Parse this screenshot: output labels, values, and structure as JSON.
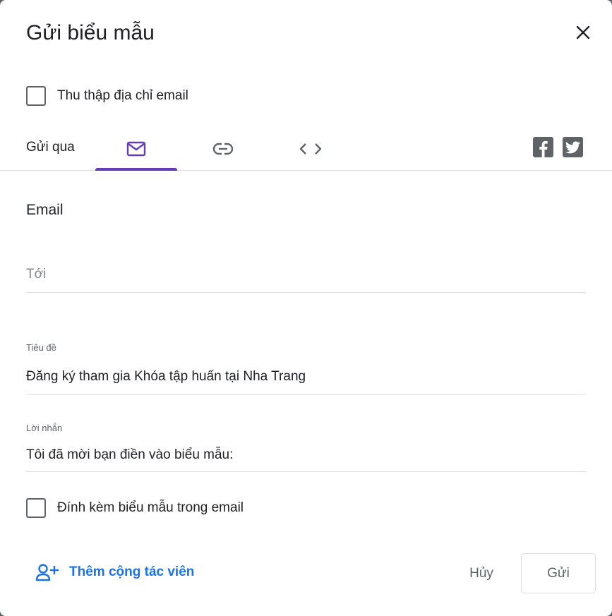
{
  "dialog": {
    "title": "Gửi biểu mẫu",
    "close_icon": "close-icon"
  },
  "collect_email": {
    "label": "Thu thập địa chỉ email",
    "checked": false
  },
  "send_via": {
    "label": "Gửi qua",
    "tabs": [
      {
        "name": "email",
        "icon": "mail-icon",
        "active": true
      },
      {
        "name": "link",
        "icon": "link-icon",
        "active": false
      },
      {
        "name": "embed",
        "icon": "code-icon",
        "active": false
      }
    ],
    "social": [
      {
        "name": "facebook",
        "icon": "facebook-icon"
      },
      {
        "name": "twitter",
        "icon": "twitter-icon"
      }
    ],
    "accent_color": "#673ab7"
  },
  "email_section": {
    "heading": "Email",
    "to": {
      "placeholder": "Tới",
      "value": ""
    },
    "subject": {
      "label": "Tiêu đề",
      "value": "Đăng ký tham gia Khóa tập huấn tại Nha Trang"
    },
    "message": {
      "label": "Lời nhắn",
      "value": "Tôi đã mời bạn điền vào biểu mẫu:"
    },
    "include_form": {
      "label": "Đính kèm biểu mẫu trong email",
      "checked": false
    }
  },
  "footer": {
    "add_collaborators": {
      "label": "Thêm cộng tác viên",
      "icon": "add-person-icon",
      "color": "#1a73e8"
    },
    "cancel_label": "Hủy",
    "send_label": "Gửi"
  }
}
